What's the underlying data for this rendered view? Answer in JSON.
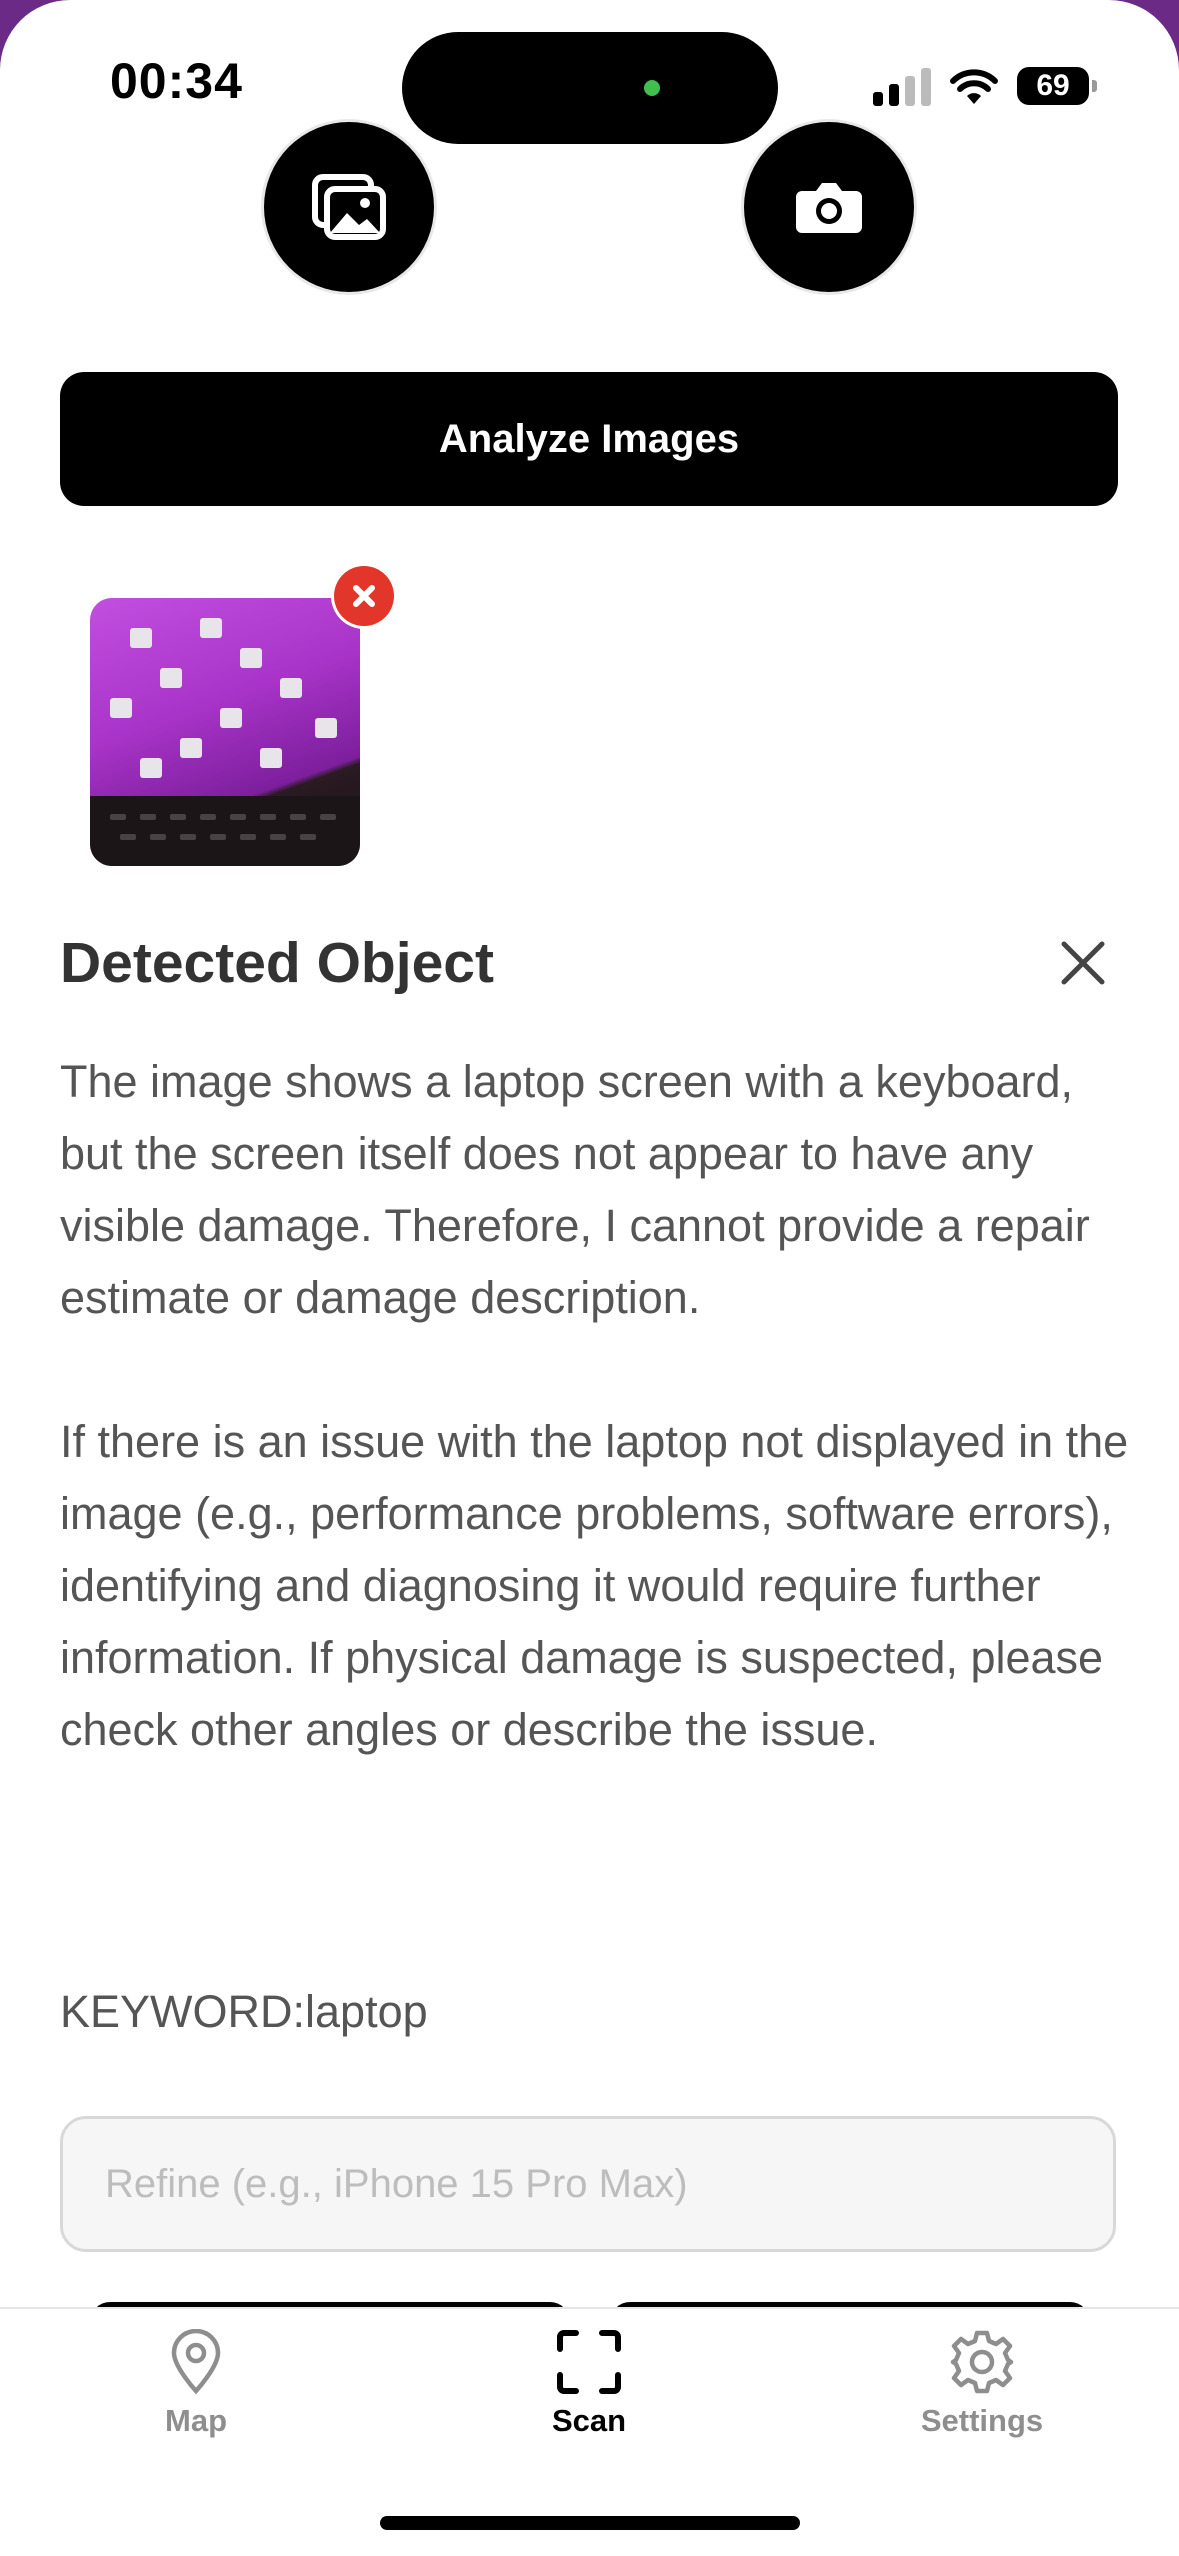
{
  "status_bar": {
    "time": "00:34",
    "battery": "69"
  },
  "toolbar": {
    "analyze_label": "Analyze Images"
  },
  "detected": {
    "title": "Detected Object",
    "paragraph_1": "The image shows a laptop screen with a keyboard, but the screen itself does not appear to have any visible damage. Therefore, I cannot provide a repair estimate or damage description.",
    "paragraph_2": "If there is an issue with the laptop not displayed in the image (e.g., performance problems, software errors), identifying and diagnosing it would require further information. If physical damage is suspected, please check other angles or describe the issue.",
    "keyword": "KEYWORD:laptop"
  },
  "refine": {
    "placeholder": "Refine (e.g., iPhone 15 Pro Max)",
    "value": ""
  },
  "tabs": [
    {
      "label": "Map",
      "icon": "map-pin-icon",
      "active": false
    },
    {
      "label": "Scan",
      "icon": "scan-icon",
      "active": true
    },
    {
      "label": "Settings",
      "icon": "gear-icon",
      "active": false
    }
  ],
  "colors": {
    "accent": "#000000",
    "remove": "#e3362b",
    "text": "#555555"
  }
}
